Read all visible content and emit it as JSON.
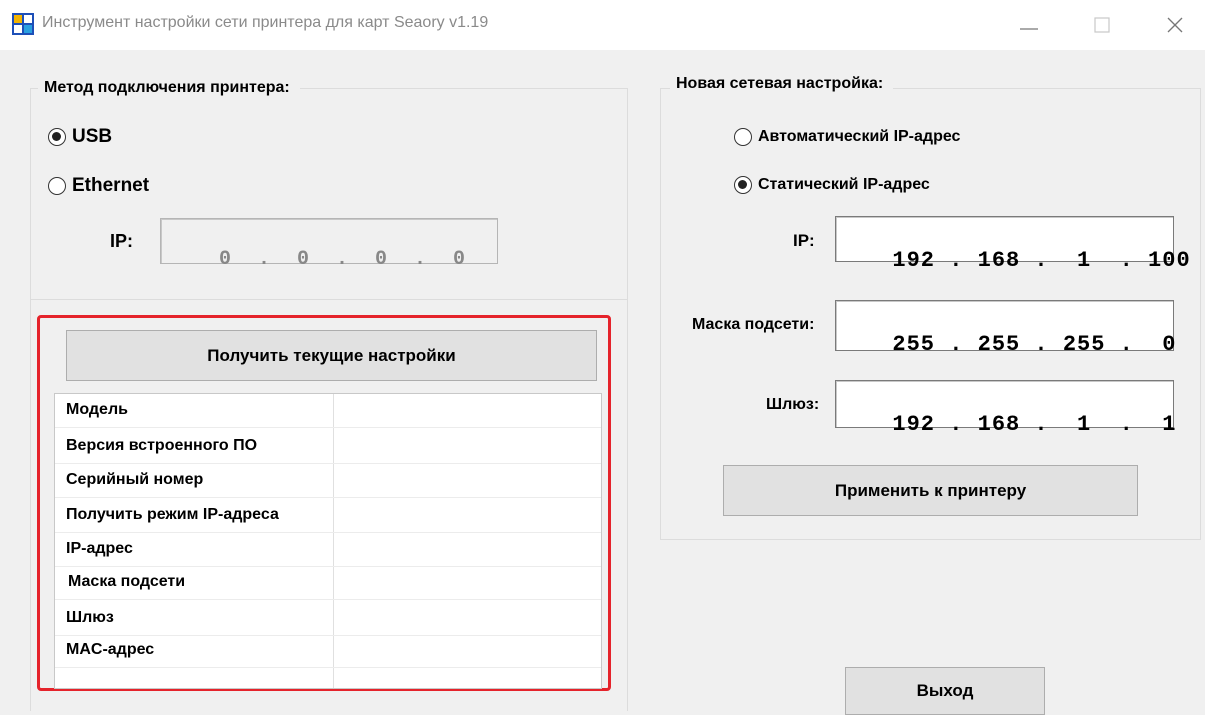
{
  "window": {
    "title": "Инструмент настройки сети принтера для карт Seaory v1.19",
    "controls": [
      "minimize-icon",
      "maximize-icon",
      "close-icon"
    ]
  },
  "connection": {
    "group_title": "Метод подключения принтера:",
    "usb_label": "USB",
    "ethernet_label": "Ethernet",
    "selected": "USB",
    "ip_label": "IP:",
    "ip_value": "0  .  0  .  0  .  0"
  },
  "current": {
    "get_button": "Получить текущие настройки",
    "rows": [
      "Модель",
      "Версия встроенного ПО",
      "Серийный номер",
      "Получить режим IP-адреса",
      "IP-адрес",
      "Маска подсети",
      "Шлюз",
      "MAC-адрес"
    ]
  },
  "network": {
    "group_title": "Новая сетевая настройка:",
    "auto_label": "Автоматический IP-адрес",
    "static_label": "Статический IP-адрес",
    "selected": "Статический IP-адрес",
    "ip_label": "IP:",
    "ip_value": "192 . 168 .  1  . 100",
    "mask_label": "Маска подсети:",
    "mask_value": "255 . 255 . 255 .  0",
    "gateway_label": "Шлюз:",
    "gateway_value": "192 . 168 .  1  .  1",
    "apply_button": "Применить к принтеру"
  },
  "footer": {
    "exit_button": "Выход"
  },
  "colors": {
    "highlight": "#e5232b",
    "background": "#f0f0f0"
  }
}
